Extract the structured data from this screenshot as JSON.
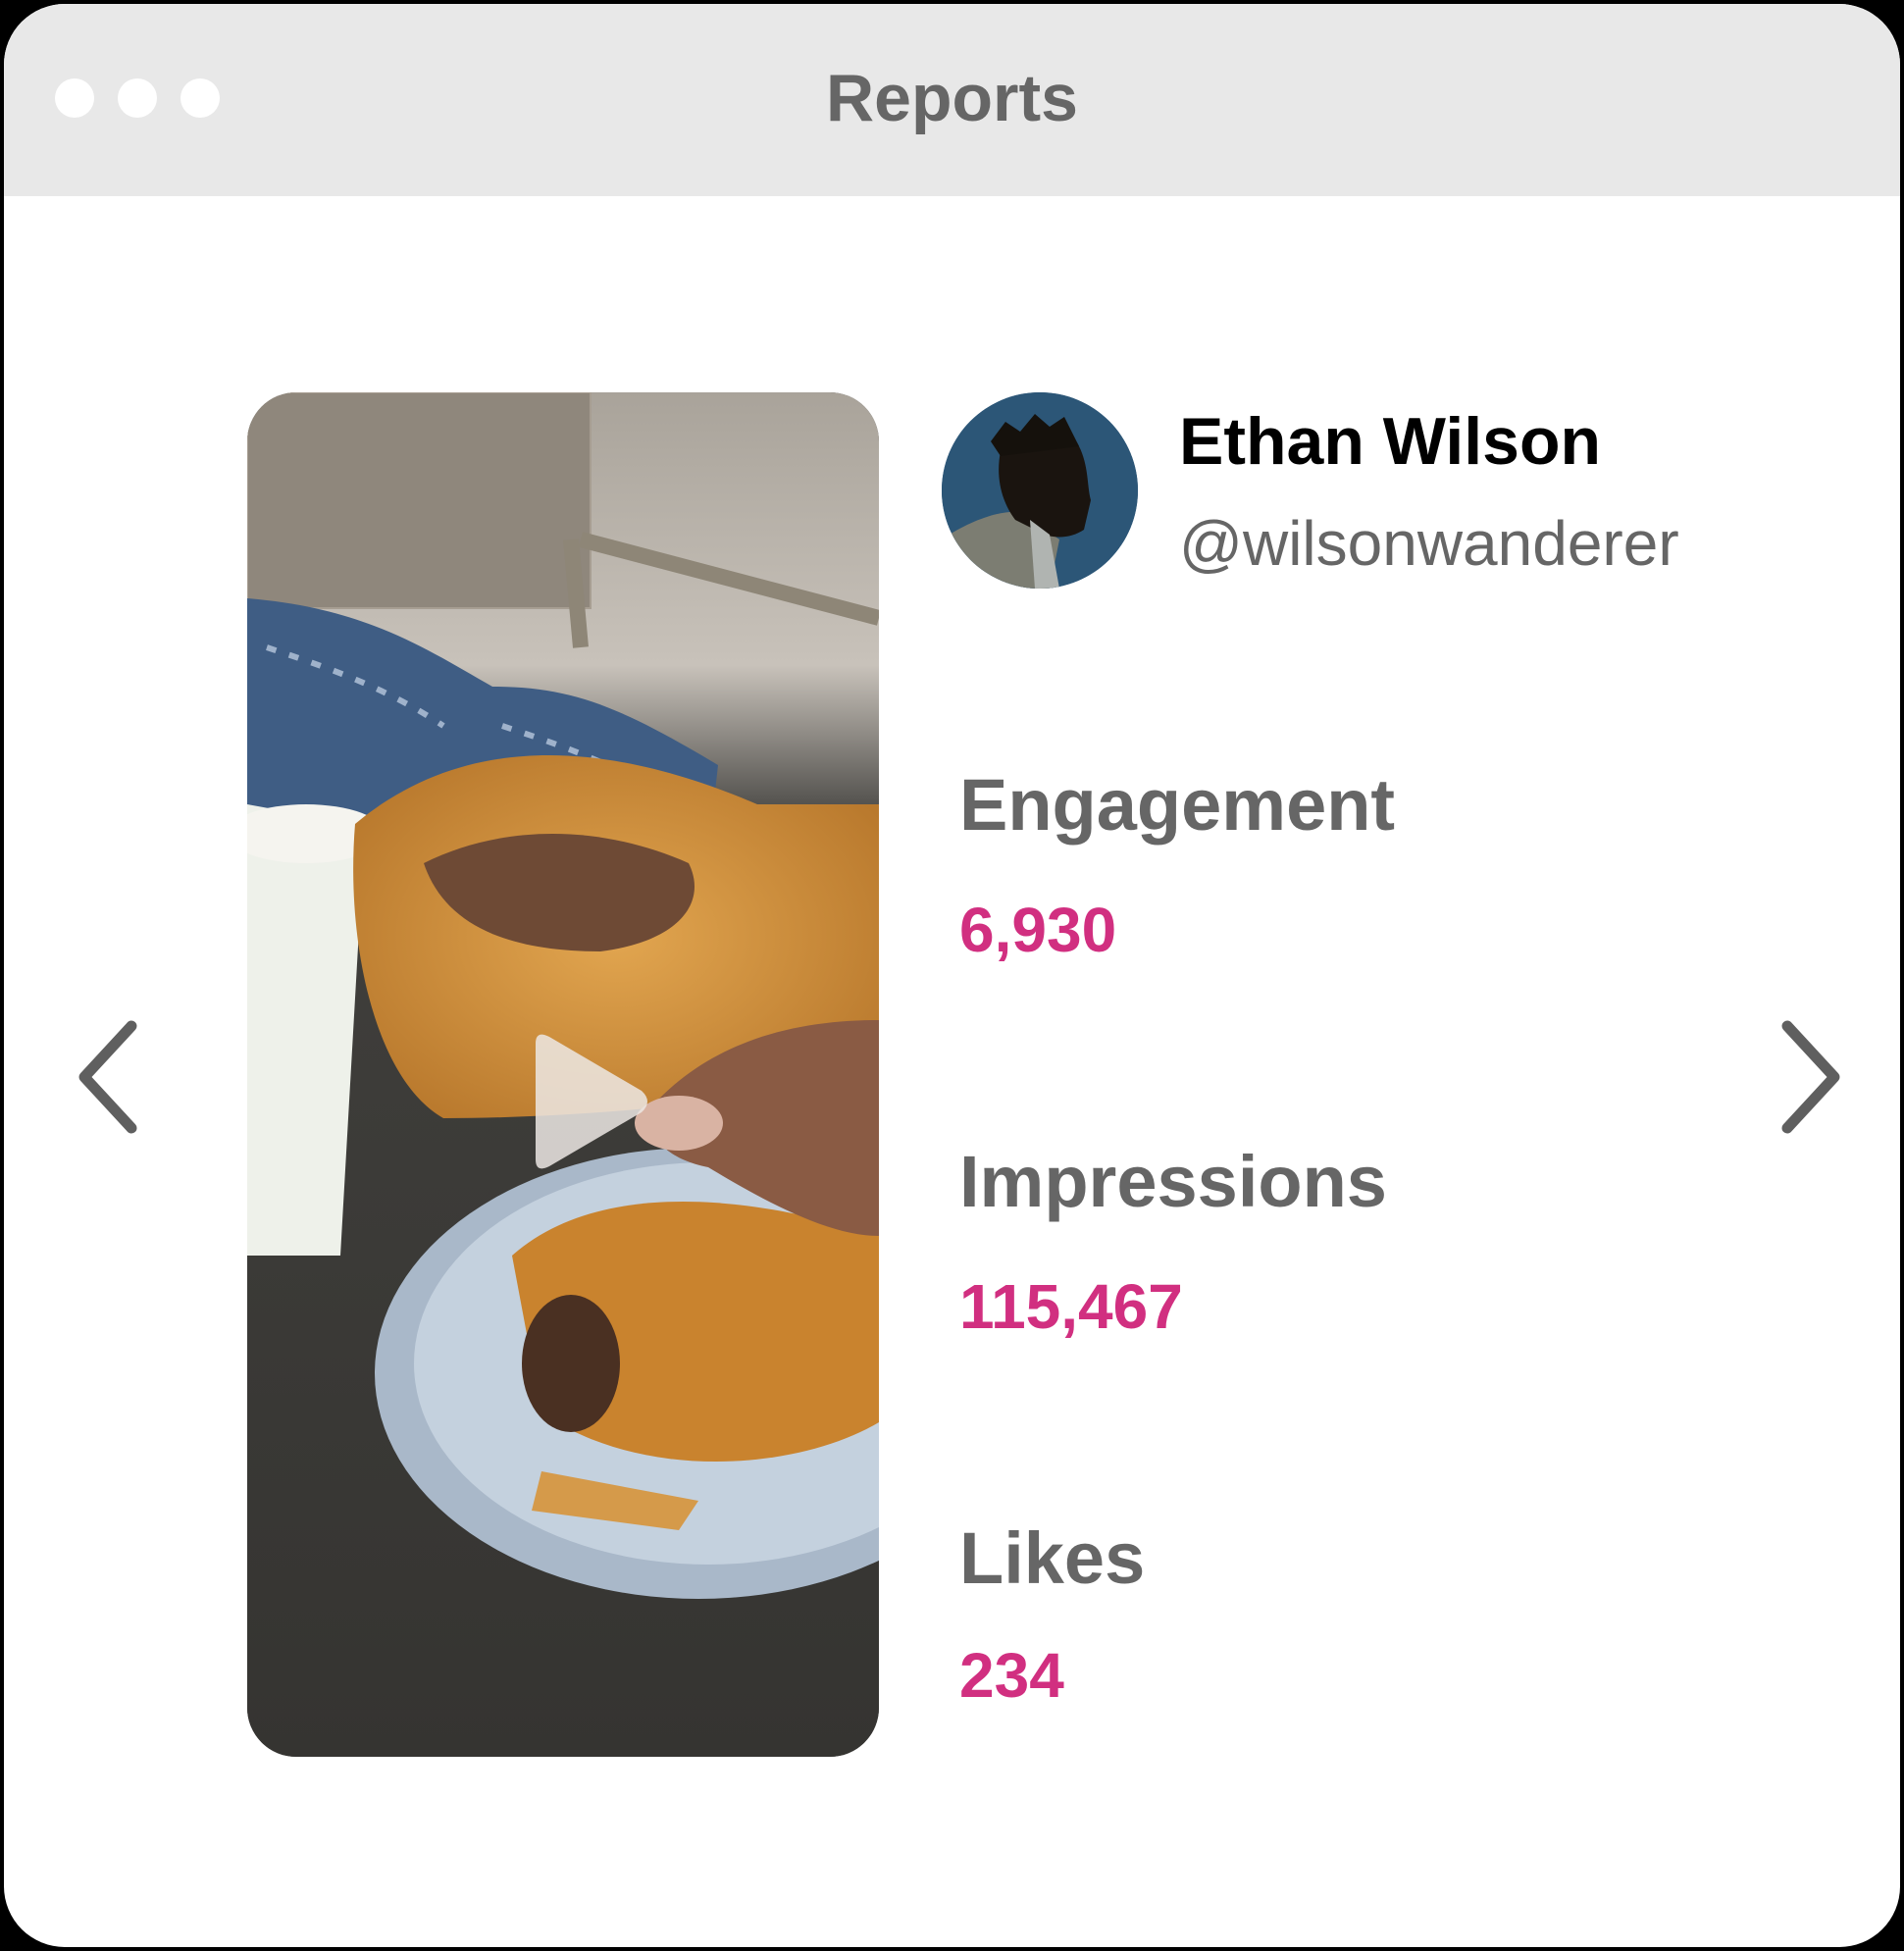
{
  "window": {
    "title": "Reports",
    "controls": [
      "close-dot",
      "minimize-dot",
      "maximize-dot"
    ]
  },
  "post": {
    "media_type": "video",
    "media_description": "Chocolate-filled croissant held over a plate next to a coffee cup",
    "play_icon": "play-icon"
  },
  "profile": {
    "name": "Ethan Wilson",
    "handle": "@wilsonwanderer"
  },
  "stats": [
    {
      "label": "Engagement",
      "value": "6,930"
    },
    {
      "label": "Impressions",
      "value": "115,467"
    },
    {
      "label": "Likes",
      "value": "234"
    }
  ],
  "navigation": {
    "prev_icon": "chevron-left-icon",
    "next_icon": "chevron-right-icon"
  },
  "colors": {
    "accent": "#d12f80",
    "label": "#666666",
    "titlebar": "#e8e8e8"
  }
}
